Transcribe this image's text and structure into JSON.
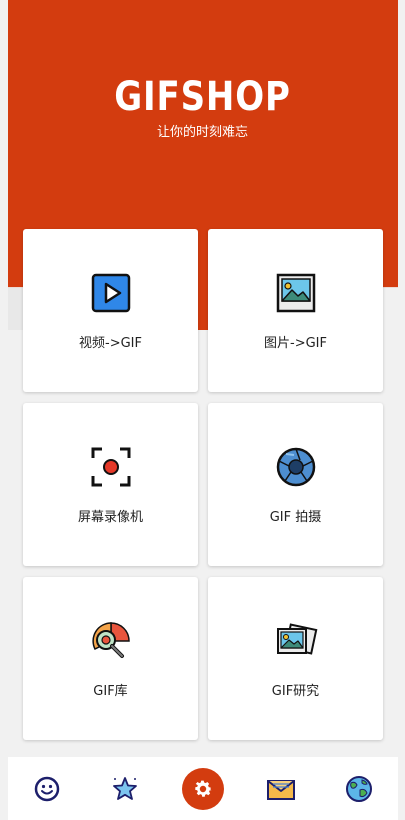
{
  "header": {
    "title": "GIFSHOP",
    "subtitle": "让你的时刻难忘"
  },
  "cards": [
    {
      "label": "视频->GIF",
      "icon": "play-video-icon"
    },
    {
      "label": "图片->GIF",
      "icon": "picture-icon"
    },
    {
      "label": "屏幕录像机",
      "icon": "screen-record-icon"
    },
    {
      "label": "GIF 拍摄",
      "icon": "camera-aperture-icon"
    },
    {
      "label": "GIF库",
      "icon": "gif-library-search-icon"
    },
    {
      "label": "GIF研究",
      "icon": "gallery-images-icon"
    }
  ],
  "bottom_nav": [
    {
      "icon": "smiley-icon"
    },
    {
      "icon": "star-icon"
    },
    {
      "icon": "settings-gear-icon",
      "active": true
    },
    {
      "icon": "mail-envelope-icon"
    },
    {
      "icon": "globe-icon"
    }
  ],
  "colors": {
    "brand": "#d33c0f",
    "background": "#f1f1f1",
    "card": "#ffffff"
  }
}
